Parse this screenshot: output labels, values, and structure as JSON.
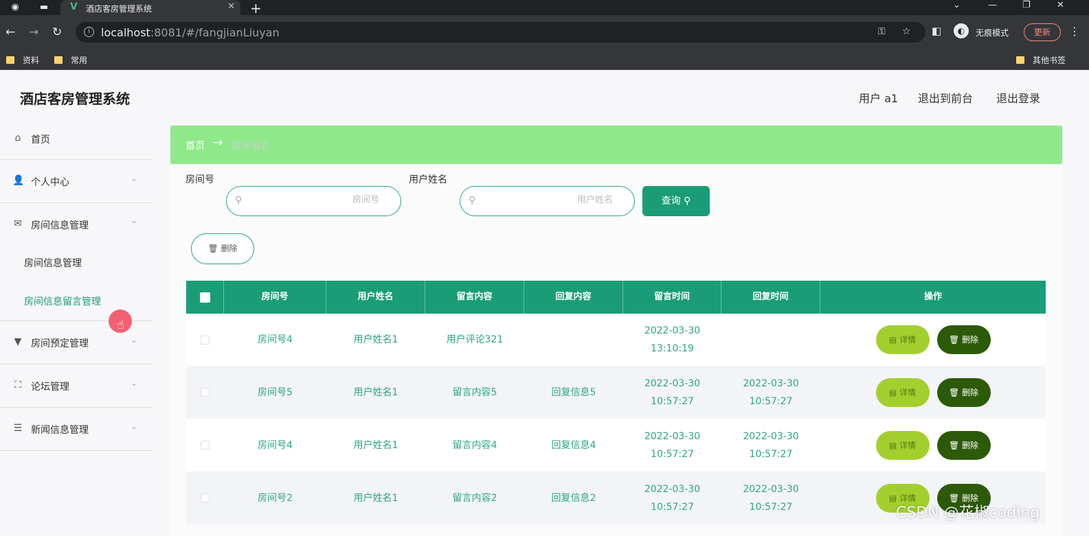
{
  "browser": {
    "tab_title": "酒店客房管理系统",
    "tab_close": "✕",
    "new_tab": "+",
    "url_host": "localhost",
    "url_path": ":8081/#/fangjianLiuyan",
    "incognito_label": "无痕模式",
    "update_button": "更新",
    "bookmarks": [
      "资料",
      "常用"
    ],
    "other_bookmarks": "其他书签"
  },
  "header": {
    "system_title": "酒店客房管理系统",
    "user_label": "用户 a1",
    "exit_to_front": "退出到前台",
    "logout": "退出登录"
  },
  "sidebar": {
    "home": "首页",
    "personal_center": "个人中心",
    "room_info_mgmt": "房间信息管理",
    "sub_items": [
      "房间信息管理",
      "房间信息留言管理"
    ],
    "room_booking_mgmt": "房间预定管理",
    "forum_mgmt": "论坛管理",
    "news_mgmt": "新闻信息管理"
  },
  "breadcrumb": {
    "home": "首页",
    "separator": "→",
    "current": "房间留言"
  },
  "filters": {
    "room_label": "房间号",
    "room_placeholder": "房间号",
    "user_label": "用户姓名",
    "user_placeholder": "用户姓名",
    "query_button": "查询",
    "delete_button": "删除"
  },
  "table": {
    "headers": [
      "房间号",
      "用户姓名",
      "留言内容",
      "回复内容",
      "留言时间",
      "回复时间",
      "操作"
    ],
    "detail_label": "详情",
    "delete_label": "删除",
    "rows": [
      {
        "room": "房间号4",
        "user": "用户姓名1",
        "content": "用户评论321",
        "reply": "",
        "time": "2022-03-30 13:10:19",
        "reply_time": ""
      },
      {
        "room": "房间号5",
        "user": "用户姓名1",
        "content": "留言内容5",
        "reply": "回复信息5",
        "time": "2022-03-30 10:57:27",
        "reply_time": "2022-03-30 10:57:27"
      },
      {
        "room": "房间号4",
        "user": "用户姓名1",
        "content": "留言内容4",
        "reply": "回复信息4",
        "time": "2022-03-30 10:57:27",
        "reply_time": "2022-03-30 10:57:27"
      },
      {
        "room": "房间号2",
        "user": "用户姓名1",
        "content": "留言内容2",
        "reply": "回复信息2",
        "time": "2022-03-30 10:57:27",
        "reply_time": "2022-03-30 10:57:27"
      }
    ]
  },
  "watermark": "CSDN @花椒coding",
  "colors": {
    "accent": "#1a9d77",
    "breadcrumb_bg": "#8fe98a",
    "detail_btn": "#a3cf2e",
    "delete_btn": "#2c5a08"
  }
}
